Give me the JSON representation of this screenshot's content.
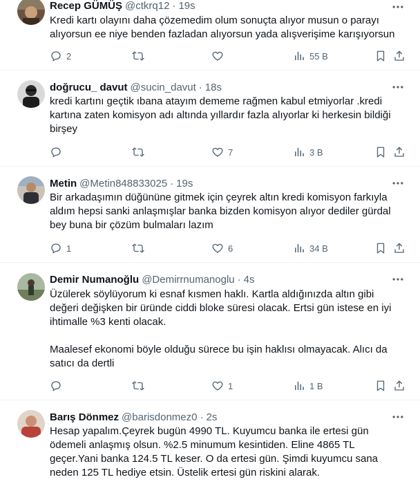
{
  "tweets": [
    {
      "name": "Recep GÜMÜŞ",
      "handle": "@ctkrq12",
      "dot": "·",
      "time": "19s",
      "lines": [
        "Kredi kartı olayını daha çözemedim olum sonuçta alıyor musun o parayı",
        "alıyorsun ee niye benden fazladan alıyorsun yada alışverişime karışıyorsun"
      ],
      "replies": "2",
      "retweets": "",
      "likes": "",
      "views": "55 B"
    },
    {
      "name": "doğrucu_ davut",
      "handle": "@sucin_davut",
      "dot": "·",
      "time": "18s",
      "lines": [
        "kredi kartını geçtik ıbana atayım dememe rağmen kabul etmiyorlar .kredi",
        "kartına zaten komisyon adı altında yıllardır fazla alıyorlar ki herkesin bildiği",
        "birşey"
      ],
      "replies": "",
      "retweets": "",
      "likes": "7",
      "views": "3 B"
    },
    {
      "name": "Metin",
      "handle": "@Metin848833025",
      "dot": "·",
      "time": "19s",
      "lines": [
        "Bir arkadaşımın düğününe gitmek için çeyrek altın kredi komisyon farkıyla",
        "aldım  hepsi sanki anlaşmışlar banka bizden komisyon alıyor dediler gürdal",
        "bey buna bir çözüm bulmaları lazım"
      ],
      "replies": "1",
      "retweets": "",
      "likes": "6",
      "views": "34 B"
    },
    {
      "name": "Demir Numanoğlu",
      "handle": "@Demirrnumanoglu",
      "dot": "·",
      "time": "4s",
      "lines": [
        "Üzülerek söylüyorum ki esnaf kısmen haklı. Kartla aldığınızda altın gibi",
        "değeri değişken bir üründe ciddi bloke süresi olacak. Ertsi gün istese en iyi",
        "ihtimalle %3 kenti olacak.",
        "",
        "Maalesef ekonomi böyle olduğu sürece bu işin haklısı olmayacak. Alıcı da",
        "satıcı da dertli"
      ],
      "replies": "",
      "retweets": "",
      "likes": "1",
      "views": "1 B"
    },
    {
      "name": "Barış Dönmez",
      "handle": "@barisdonmez0",
      "dot": "·",
      "time": "2s",
      "lines": [
        "Hesap yapalım.Çeyrek bugün 4990 TL. Kuyumcu banka ile ertesi gün",
        "ödemeli anlaşmış olsun. %2.5 minumum kesintiden. Eline 4865 TL",
        "geçer.Yani banka 124.5 TL keser. O da ertesi gün. Şimdi kuyumcu sana",
        "neden 125 TL hediye etsin. Üstelik ertesi gün riskini alarak."
      ],
      "replies": "",
      "retweets": "",
      "likes": "",
      "views": ""
    }
  ],
  "icons": {
    "reply": "reply-icon",
    "retweet": "retweet-icon",
    "like": "heart-icon",
    "views": "views-icon",
    "bookmark": "bookmark-icon",
    "share": "share-icon",
    "more": "more-icon"
  },
  "colors": {
    "text": "#0f1419",
    "secondary": "#536471",
    "divider": "#eff3f4"
  }
}
